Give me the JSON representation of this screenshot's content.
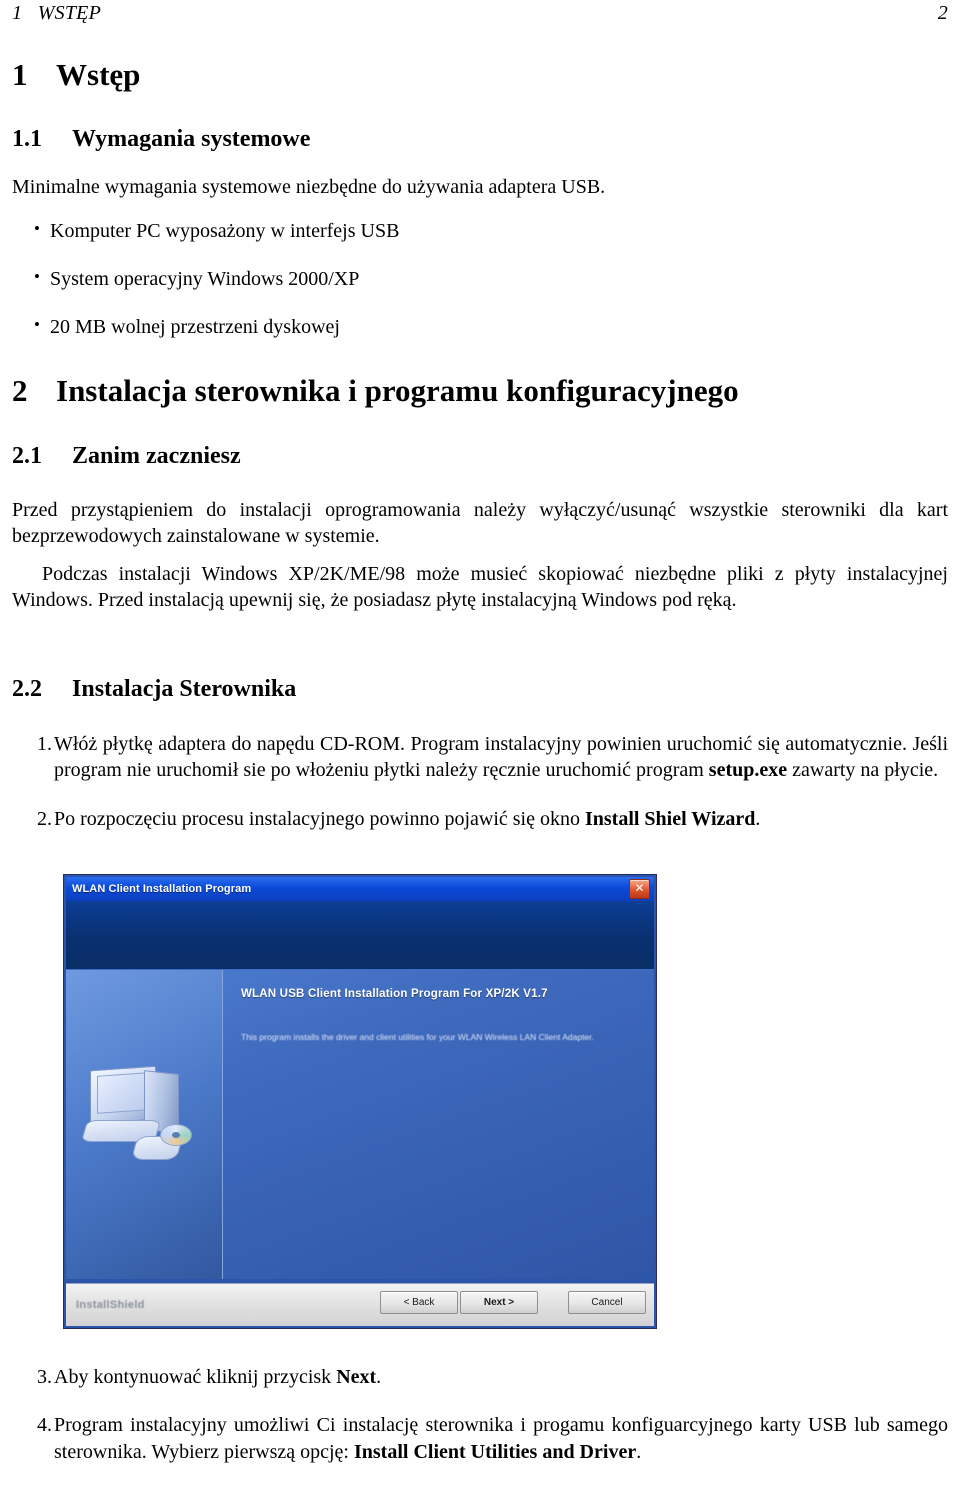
{
  "header": {
    "left": "1   WSTĘP",
    "page_number": "2"
  },
  "sections": {
    "s1": {
      "number": "1",
      "title": "Wstęp"
    },
    "s1_1": {
      "number": "1.1",
      "title": "Wymagania systemowe"
    },
    "s1_1_intro": "Minimalne wymagania systemowe niezbędne do używania adaptera USB.",
    "requirements": [
      "Komputer PC wyposażony w interfejs USB",
      "System operacyjny Windows 2000/XP",
      "20 MB wolnej przestrzeni dyskowej"
    ],
    "s2": {
      "number": "2",
      "title": "Instalacja sterownika i programu konfiguracyjnego"
    },
    "s2_1": {
      "number": "2.1",
      "title": "Zanim zaczniesz"
    },
    "s2_1_p1": "Przed przystąpieniem do instalacji oprogramowania należy wyłączyć/usunąć wszystkie sterowniki dla kart bezprzewodowych zainstalowane w systemie.",
    "s2_1_p2": "Podczas instalacji Windows XP/2K/ME/98 może musieć skopiować niezbędne pliki z płyty instalacyjnej Windows. Przed instalacją upewnij się, że posiadasz płytę instalacyjną Windows pod ręką.",
    "s2_2": {
      "number": "2.2",
      "title": "Instalacja Sterownika"
    }
  },
  "steps": [
    {
      "marker": "1.",
      "parts": [
        {
          "text": "Włóż płytkę adaptera do napędu CD-ROM. Program instalacyjny powinien uruchomić się automatycznie. Jeśli program nie uruchomił sie po włożeniu płytki należy ręcznie uruchomić program ",
          "bold": false
        },
        {
          "text": "setup.exe",
          "bold": true
        },
        {
          "text": " zawarty na płycie.",
          "bold": false
        }
      ]
    },
    {
      "marker": "2.",
      "parts": [
        {
          "text": "Po rozpoczęciu procesu instalacyjnego powinno pojawić się okno ",
          "bold": false
        },
        {
          "text": "Install Shiel Wizard",
          "bold": true
        },
        {
          "text": ".",
          "bold": false
        }
      ]
    },
    {
      "marker": "3.",
      "parts": [
        {
          "text": "Aby kontynuować kliknij przycisk ",
          "bold": false
        },
        {
          "text": "Next",
          "bold": true
        },
        {
          "text": ".",
          "bold": false
        }
      ]
    },
    {
      "marker": "4.",
      "parts": [
        {
          "text": "Program instalacyjny umożliwi Ci instalację sterownika i progamu konfiguarcyjnego karty USB lub samego sterownika. Wybierz pierwszą opcję: ",
          "bold": false
        },
        {
          "text": "Install Client Utilities and Driver",
          "bold": true
        },
        {
          "text": ".",
          "bold": false
        }
      ]
    }
  ],
  "figure": {
    "window_title": "WLAN Client Installation Program",
    "close_label": "✕",
    "heading": "WLAN USB Client Installation Program For XP/2K V1.7",
    "description": "This program installs the driver and client utilities for your WLAN Wireless LAN Client Adapter.",
    "installshield_logo": "InstallShield",
    "buttons": {
      "back": "< Back",
      "next": "Next >",
      "cancel": "Cancel"
    }
  },
  "colors": {
    "titlebar_blue": "#0a4ad8",
    "banner_navy": "#0a3070",
    "body_blue": "#3e69bd",
    "close_red": "#e2562a",
    "footer_gray": "#e3e3e3"
  }
}
